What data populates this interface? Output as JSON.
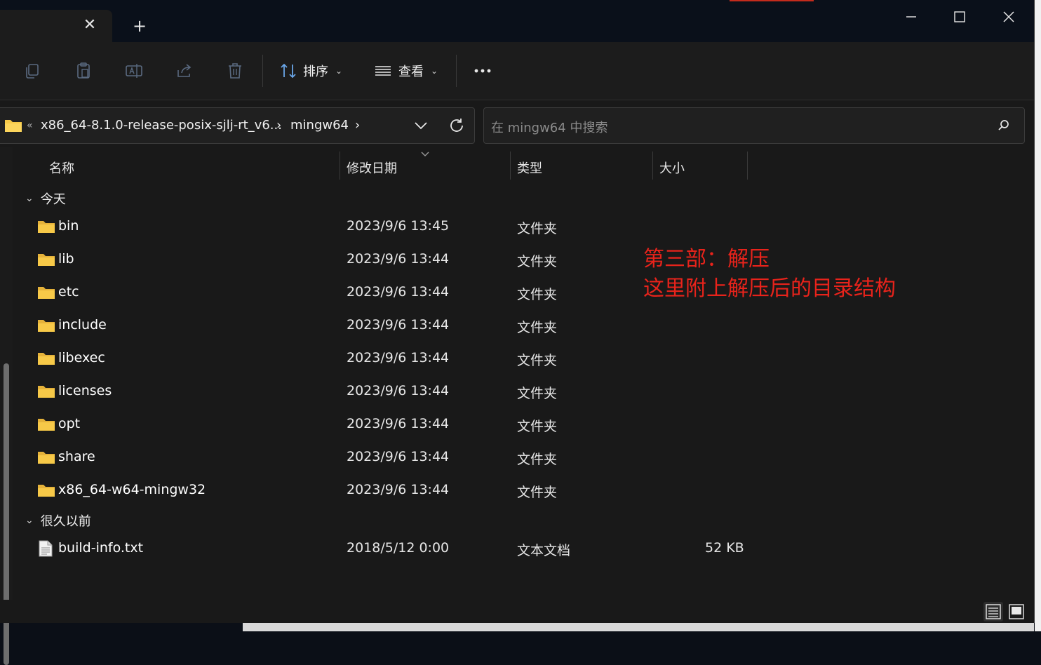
{
  "window": {
    "tab_close_icon": "close-icon",
    "new_tab_icon": "plus-icon",
    "controls": [
      "minimize-icon",
      "maximize-icon",
      "close-icon"
    ]
  },
  "toolbar": {
    "sort_label": "排序",
    "view_label": "查看",
    "more_icon": "ellipsis-icon"
  },
  "address": {
    "overflow": "«",
    "crumb1": "x86_64-8.1.0-release-posix-sjlj-rt_v6...",
    "crumb2": "mingw64",
    "sep": "›"
  },
  "search": {
    "placeholder": "在 mingw64 中搜索"
  },
  "columns": {
    "name": "名称",
    "date": "修改日期",
    "type": "类型",
    "size": "大小"
  },
  "groups": [
    {
      "label": "今天",
      "items": [
        {
          "name": "bin",
          "date": "2023/9/6 13:45",
          "type": "文件夹",
          "size": ""
        },
        {
          "name": "lib",
          "date": "2023/9/6 13:44",
          "type": "文件夹",
          "size": ""
        },
        {
          "name": "etc",
          "date": "2023/9/6 13:44",
          "type": "文件夹",
          "size": ""
        },
        {
          "name": "include",
          "date": "2023/9/6 13:44",
          "type": "文件夹",
          "size": ""
        },
        {
          "name": "libexec",
          "date": "2023/9/6 13:44",
          "type": "文件夹",
          "size": ""
        },
        {
          "name": "licenses",
          "date": "2023/9/6 13:44",
          "type": "文件夹",
          "size": ""
        },
        {
          "name": "opt",
          "date": "2023/9/6 13:44",
          "type": "文件夹",
          "size": ""
        },
        {
          "name": "share",
          "date": "2023/9/6 13:44",
          "type": "文件夹",
          "size": ""
        },
        {
          "name": "x86_64-w64-mingw32",
          "date": "2023/9/6 13:44",
          "type": "文件夹",
          "size": ""
        }
      ]
    },
    {
      "label": "很久以前",
      "items": [
        {
          "name": "build-info.txt",
          "date": "2018/5/12 0:00",
          "type": "文本文档",
          "size": "52 KB"
        }
      ]
    }
  ],
  "annotation": {
    "line1": "第三部：解压",
    "line2": "这里附上解压后的目录结构"
  },
  "colors": {
    "annotation": "#e8231b",
    "folder": "#f7c948",
    "background": "#191919"
  }
}
